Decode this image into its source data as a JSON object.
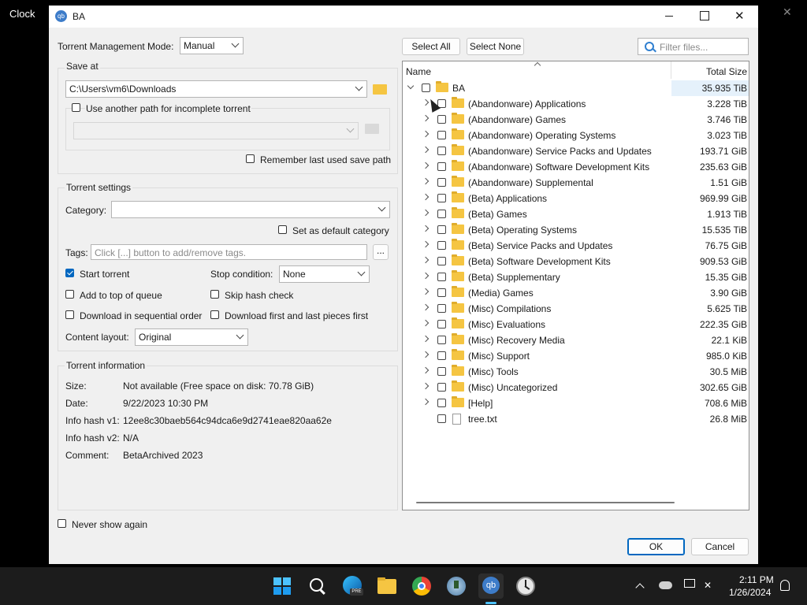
{
  "desktop": {
    "clock_app_title": "Clock",
    "close_symbol": "✕"
  },
  "window": {
    "title": "BA",
    "icon": "qbittorrent-icon",
    "minimize": "—",
    "maximize": "☐",
    "close": "✕"
  },
  "left": {
    "management_mode_label": "Torrent Management Mode:",
    "management_mode_value": "Manual",
    "save_at_title": "Save at",
    "save_path": "C:\\Users\\vm6\\Downloads",
    "use_another_path_label": "Use another path for incomplete torrent",
    "remember_path_label": "Remember last used save path",
    "torrent_settings_title": "Torrent settings",
    "category_label": "Category:",
    "category_value": "",
    "set_default_category_label": "Set as default category",
    "tags_label": "Tags:",
    "tags_placeholder": "Click [...] button to add/remove tags.",
    "tags_button": "...",
    "start_torrent_label": "Start torrent",
    "stop_condition_label": "Stop condition:",
    "stop_condition_value": "None",
    "add_top_queue_label": "Add to top of queue",
    "skip_hash_label": "Skip hash check",
    "sequential_label": "Download in sequential order",
    "first_last_label": "Download first and last pieces first",
    "content_layout_label": "Content layout:",
    "content_layout_value": "Original",
    "info_title": "Torrent information",
    "info": [
      {
        "key": "Size:",
        "value": "Not available (Free space on disk: 70.78 GiB)"
      },
      {
        "key": "Date:",
        "value": "9/22/2023 10:30 PM"
      },
      {
        "key": "Info hash v1:",
        "value": "12ee8c30baeb564c94dca6e9d2741eae820aa62e"
      },
      {
        "key": "Info hash v2:",
        "value": "N/A"
      },
      {
        "key": "Comment:",
        "value": "BetaArchived 2023"
      }
    ],
    "never_show_label": "Never show again"
  },
  "right": {
    "select_all": "Select All",
    "select_none": "Select None",
    "filter_placeholder": "Filter files...",
    "col_name": "Name",
    "col_size": "Total Size",
    "root": {
      "name": "BA",
      "size": "35.935 TiB"
    },
    "items": [
      {
        "name": "(Abandonware) Applications",
        "size": "3.228 TiB",
        "type": "folder"
      },
      {
        "name": "(Abandonware) Games",
        "size": "3.746 TiB",
        "type": "folder"
      },
      {
        "name": "(Abandonware) Operating Systems",
        "size": "3.023 TiB",
        "type": "folder"
      },
      {
        "name": "(Abandonware) Service Packs and Updates",
        "size": "193.71 GiB",
        "type": "folder"
      },
      {
        "name": "(Abandonware) Software Development Kits",
        "size": "235.63 GiB",
        "type": "folder"
      },
      {
        "name": "(Abandonware) Supplemental",
        "size": "1.51 GiB",
        "type": "folder"
      },
      {
        "name": "(Beta) Applications",
        "size": "969.99 GiB",
        "type": "folder"
      },
      {
        "name": "(Beta) Games",
        "size": "1.913 TiB",
        "type": "folder"
      },
      {
        "name": "(Beta) Operating Systems",
        "size": "15.535 TiB",
        "type": "folder"
      },
      {
        "name": "(Beta) Service Packs and Updates",
        "size": "76.75 GiB",
        "type": "folder"
      },
      {
        "name": "(Beta) Software Development Kits",
        "size": "909.53 GiB",
        "type": "folder"
      },
      {
        "name": "(Beta) Supplementary",
        "size": "15.35 GiB",
        "type": "folder"
      },
      {
        "name": "(Media) Games",
        "size": "3.90 GiB",
        "type": "folder"
      },
      {
        "name": "(Misc) Compilations",
        "size": "5.625 TiB",
        "type": "folder"
      },
      {
        "name": "(Misc) Evaluations",
        "size": "222.35 GiB",
        "type": "folder"
      },
      {
        "name": "(Misc) Recovery Media",
        "size": "22.1 KiB",
        "type": "folder"
      },
      {
        "name": "(Misc) Support",
        "size": "985.0 KiB",
        "type": "folder"
      },
      {
        "name": "(Misc) Tools",
        "size": "30.5 MiB",
        "type": "folder"
      },
      {
        "name": "(Misc) Uncategorized",
        "size": "302.65 GiB",
        "type": "folder"
      },
      {
        "name": "[Help]",
        "size": "708.6 MiB",
        "type": "folder"
      },
      {
        "name": "tree.txt",
        "size": "26.8 MiB",
        "type": "file"
      }
    ]
  },
  "buttons": {
    "ok": "OK",
    "cancel": "Cancel"
  },
  "taskbar": {
    "time": "2:11 PM",
    "date": "1/26/2024",
    "apps": [
      "windows-start-icon",
      "search-icon",
      "edge-dev-icon",
      "file-explorer-icon",
      "chrome-icon",
      "download-manager-icon",
      "qbittorrent-icon",
      "clock-app-icon"
    ],
    "tray": [
      "chevron-up-icon",
      "onedrive-icon",
      "network-icon",
      "volume-muted-icon",
      "notifications-icon"
    ]
  },
  "colors": {
    "accent": "#0067c0",
    "selected_row": "#e5f1fb",
    "folder": "#f5c542",
    "taskbar": "#1c1c1c"
  }
}
